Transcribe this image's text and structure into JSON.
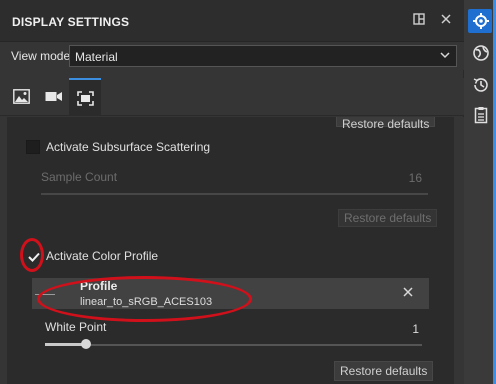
{
  "panel": {
    "title": "DISPLAY SETTINGS",
    "view_mode_label": "View mode",
    "view_mode_value": "Material"
  },
  "tabs": [
    {
      "icon": "image-icon",
      "active": false
    },
    {
      "icon": "camera-icon",
      "active": false
    },
    {
      "icon": "screen-frame-icon",
      "active": true
    }
  ],
  "content": {
    "restore_label": "Restore defaults",
    "subsurface": {
      "label": "Activate Subsurface Scattering",
      "checked": false,
      "sample_count_label": "Sample Count",
      "sample_count_value": "16",
      "sample_count_fraction": 1.0
    },
    "color_profile": {
      "label": "Activate Color Profile",
      "checked": true,
      "profile_title": "Profile",
      "profile_value": "linear_to_sRGB_ACES103",
      "white_point_label": "White Point",
      "white_point_value": "1",
      "white_point_fraction": 0.11
    }
  },
  "annotations": {
    "highlight_color": "#d0101a"
  },
  "colors": {
    "accent": "#3c8ee4",
    "panel_bg": "#353535",
    "content_bg": "#2b2b2b"
  },
  "rightbar_icons": [
    "display-settings-icon",
    "globe-icon",
    "history-icon",
    "clipboard-icon"
  ]
}
